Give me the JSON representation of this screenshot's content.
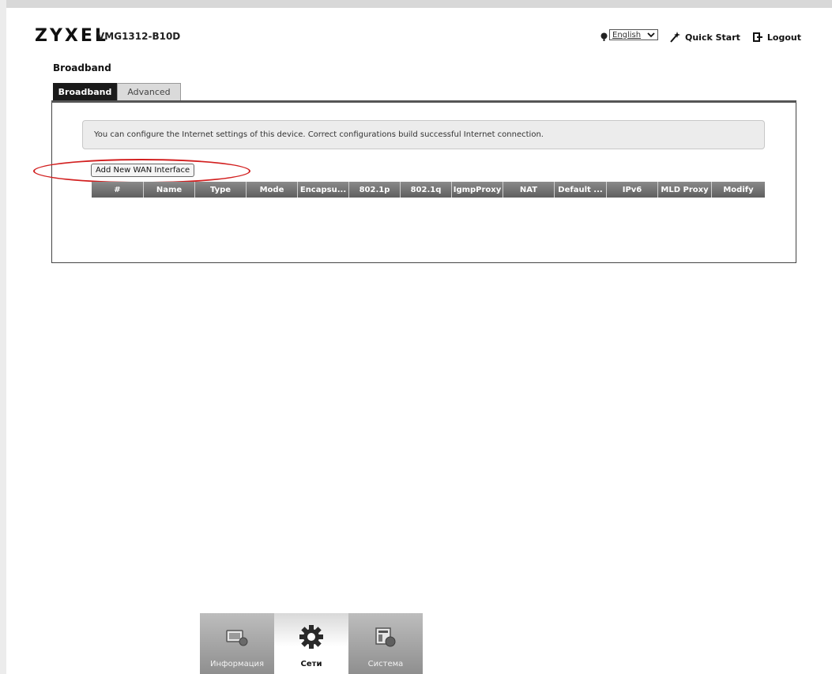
{
  "header": {
    "logo": "ZYXEL",
    "model": "VMG1312-B10D",
    "language": "English",
    "quick_start": "Quick Start",
    "logout": "Logout"
  },
  "page": {
    "title": "Broadband"
  },
  "tabs": [
    {
      "label": "Broadband",
      "active": true
    },
    {
      "label": "Advanced",
      "active": false
    }
  ],
  "info_text": "You can configure the Internet settings of this device. Correct configurations build successful Internet connection.",
  "add_button": "Add New WAN Interface",
  "table": {
    "columns": [
      "#",
      "Name",
      "Type",
      "Mode",
      "Encapsu...",
      "802.1p",
      "802.1q",
      "IgmpProxy",
      "NAT",
      "Default ...",
      "IPv6",
      "MLD Proxy",
      "Modify"
    ],
    "rows": []
  },
  "bottom_nav": [
    {
      "label": "Информация",
      "icon": "monitor-icon",
      "active": false
    },
    {
      "label": "Сети",
      "icon": "gear-icon",
      "active": true
    },
    {
      "label": "Система",
      "icon": "system-tools-icon",
      "active": false
    }
  ],
  "colors": {
    "highlight": "#d21f1f",
    "active_tab": "#1a1a1a",
    "table_header": "#6f6f6f"
  }
}
